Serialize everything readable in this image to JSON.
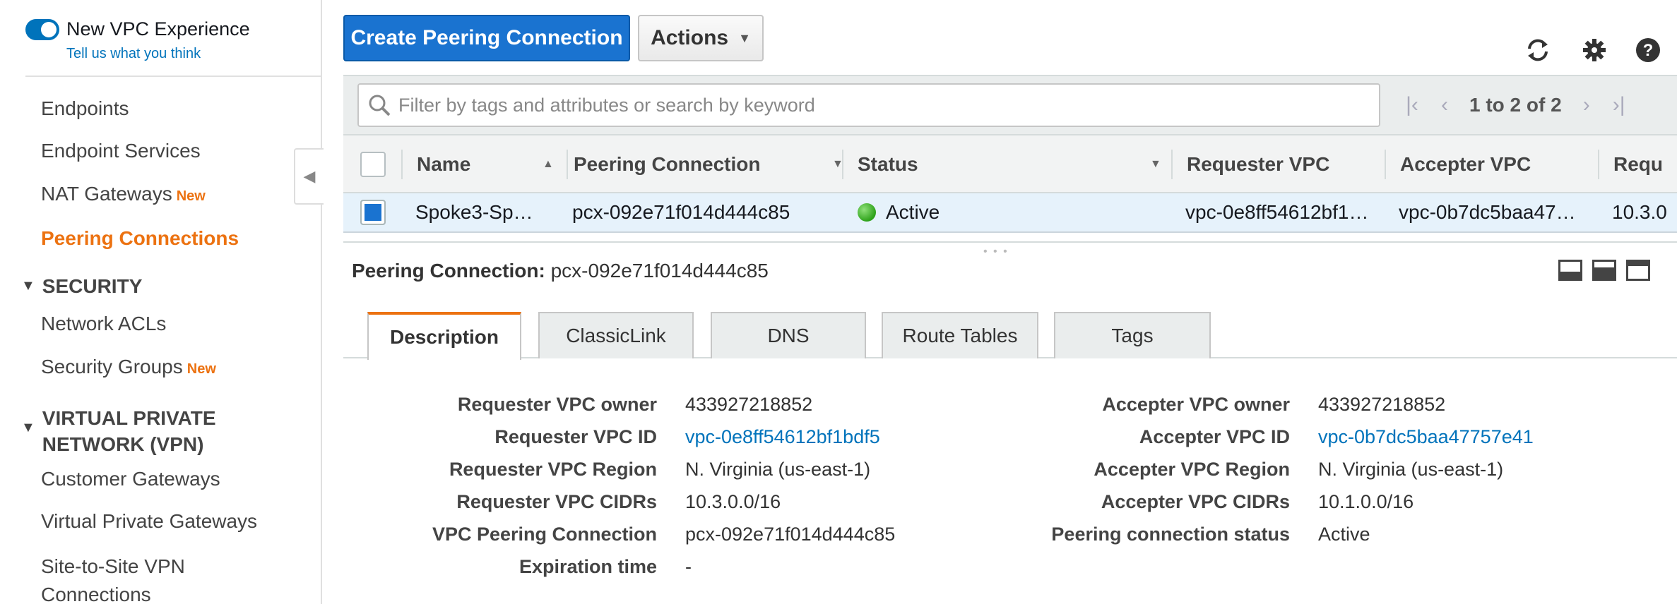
{
  "sidebar": {
    "toggle_label": "New VPC Experience",
    "feedback_link": "Tell us what you think",
    "items": [
      {
        "label": "Endpoints"
      },
      {
        "label": "Endpoint Services"
      },
      {
        "label": "NAT Gateways",
        "badge": "New"
      },
      {
        "label": "Peering Connections"
      },
      {
        "label": "Network ACLs"
      },
      {
        "label": "Security Groups",
        "badge": "New"
      },
      {
        "label": "Customer Gateways"
      },
      {
        "label": "Virtual Private Gateways"
      },
      {
        "label_line1": "Site-to-Site VPN",
        "label_line2": "Connections"
      }
    ],
    "sections": [
      {
        "label": "SECURITY"
      },
      {
        "label_line1": "VIRTUAL PRIVATE",
        "label_line2": "NETWORK (VPN)"
      }
    ]
  },
  "toolbar": {
    "create_button": "Create Peering Connection",
    "actions_button": "Actions"
  },
  "filter": {
    "placeholder": "Filter by tags and attributes or search by keyword",
    "pager_text": "1 to 2 of 2"
  },
  "table": {
    "columns": [
      "Name",
      "Peering Connection",
      "Status",
      "Requester VPC",
      "Accepter VPC",
      "Requ"
    ],
    "rows": [
      {
        "name": "Spoke3-Sp…",
        "peering_connection": "pcx-092e71f014d444c85",
        "status": "Active",
        "requester_vpc": "vpc-0e8ff54612bf1…",
        "accepter_vpc": "vpc-0b7dc5baa47…",
        "requester_cidr": "10.3.0"
      }
    ]
  },
  "details": {
    "title_label": "Peering Connection:",
    "title_value": "pcx-092e71f014d444c85",
    "tabs": [
      "Description",
      "ClassicLink",
      "DNS",
      "Route Tables",
      "Tags"
    ],
    "left": [
      {
        "label": "Requester VPC owner",
        "value": "433927218852"
      },
      {
        "label": "Requester VPC ID",
        "value": "vpc-0e8ff54612bf1bdf5"
      },
      {
        "label": "Requester VPC Region",
        "value": "N. Virginia (us-east-1)"
      },
      {
        "label": "Requester VPC CIDRs",
        "value": "10.3.0.0/16"
      },
      {
        "label": "VPC Peering Connection",
        "value": "pcx-092e71f014d444c85"
      },
      {
        "label": "Expiration time",
        "value": "-"
      }
    ],
    "right": [
      {
        "label": "Accepter VPC owner",
        "value": "433927218852"
      },
      {
        "label": "Accepter VPC ID",
        "value": "vpc-0b7dc5baa47757e41"
      },
      {
        "label": "Accepter VPC Region",
        "value": "N. Virginia (us-east-1)"
      },
      {
        "label": "Accepter VPC CIDRs",
        "value": "10.1.0.0/16"
      },
      {
        "label": "Peering connection status",
        "value": "Active"
      }
    ]
  },
  "colors": {
    "primary": "#1a73d0",
    "active_nav": "#ec7211",
    "link": "#0073bb",
    "status_active": "#2ea21a"
  }
}
